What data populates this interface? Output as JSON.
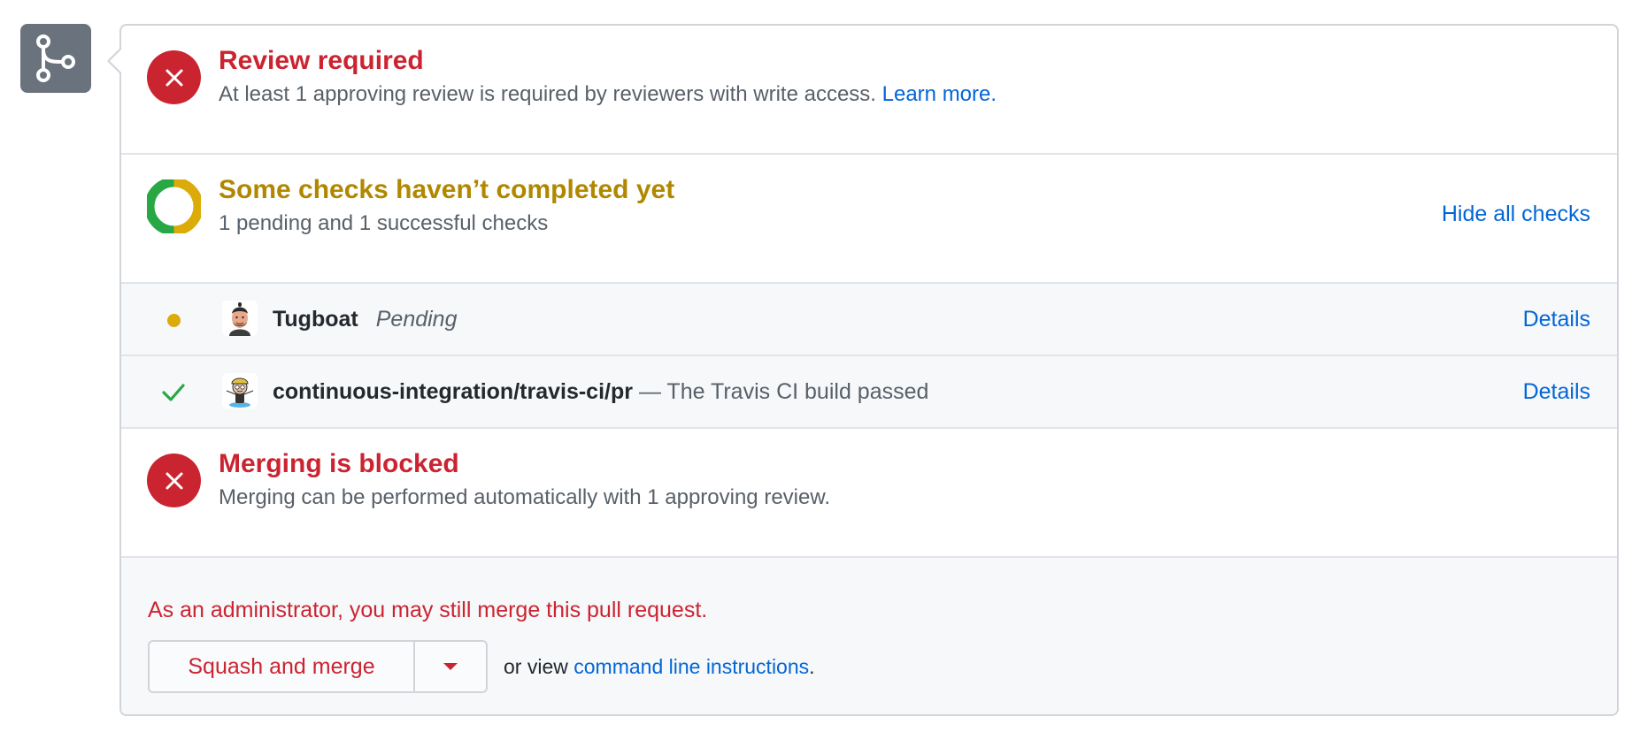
{
  "icons": {
    "merge": "git-branch-icon",
    "x": "x-icon",
    "check": "check-icon",
    "ring": "status-ring-icon",
    "pending": "pending-dot-icon",
    "caret": "caret-down-icon"
  },
  "colors": {
    "danger": "#cb2431",
    "warning": "#dbab09",
    "success": "#28a745",
    "link": "#0366d6",
    "muted": "#586069",
    "icon_bg": "#6a737d"
  },
  "review": {
    "title": "Review required",
    "description": "At least 1 approving review is required by reviewers with write access.",
    "link_label": "Learn more."
  },
  "checks": {
    "title": "Some checks haven’t completed yet",
    "summary": "1 pending and 1 successful checks",
    "toggle_label": "Hide all checks",
    "items": [
      {
        "name": "Tugboat",
        "state": "Pending",
        "description": "",
        "status": "pending",
        "details_label": "Details"
      },
      {
        "name": "continuous-integration/travis-ci/pr",
        "state": "",
        "description": "— The Travis CI build passed",
        "status": "success",
        "details_label": "Details"
      }
    ]
  },
  "blocked": {
    "title": "Merging is blocked",
    "description": "Merging can be performed automatically with 1 approving review."
  },
  "admin": {
    "note": "As an administrator, you may still merge this pull request.",
    "merge_button_label": "Squash and merge",
    "cli_prefix": "or view",
    "cli_link": "command line instructions",
    "cli_suffix": "."
  }
}
